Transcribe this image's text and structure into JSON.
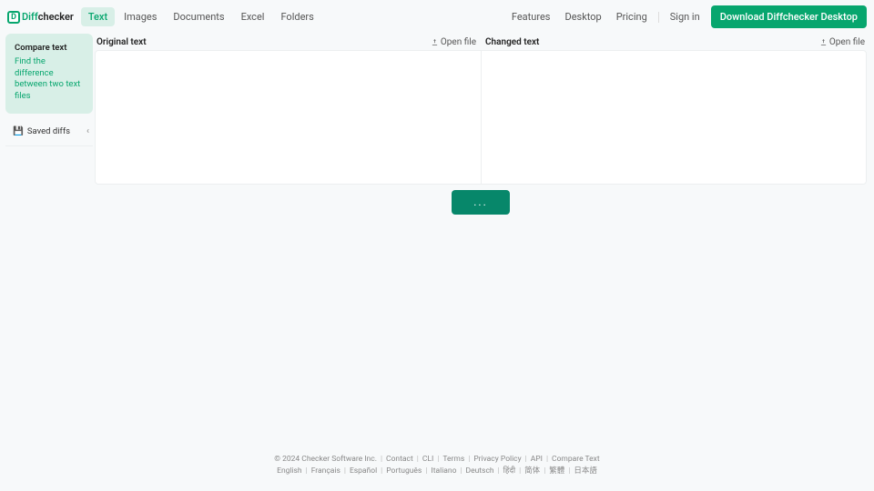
{
  "header": {
    "logo_diff": "Diff",
    "logo_checker": "checker",
    "tabs": {
      "text": "Text",
      "images": "Images",
      "documents": "Documents",
      "excel": "Excel",
      "folders": "Folders"
    },
    "features": "Features",
    "desktop": "Desktop",
    "pricing": "Pricing",
    "signin": "Sign in",
    "download": "Download Diffchecker Desktop"
  },
  "sidebar": {
    "card_title": "Compare text",
    "card_desc": "Find the difference between two text files",
    "saved_label": "Saved diffs"
  },
  "panes": {
    "original_title": "Original text",
    "changed_title": "Changed text",
    "open_file": "Open file"
  },
  "compare_button": "...",
  "footer": {
    "copyright": "© 2024 Checker Software Inc.",
    "links": {
      "contact": "Contact",
      "cli": "CLI",
      "terms": "Terms",
      "privacy": "Privacy Policy",
      "api": "API",
      "compare_text": "Compare Text"
    },
    "langs": {
      "english": "English",
      "francais": "Français",
      "espanol": "Español",
      "portugues": "Português",
      "italiano": "Italiano",
      "deutsch": "Deutsch",
      "hindi": "हिंदी",
      "zh_hans": "简体",
      "zh_hant": "繁體",
      "japanese": "日本語"
    }
  }
}
